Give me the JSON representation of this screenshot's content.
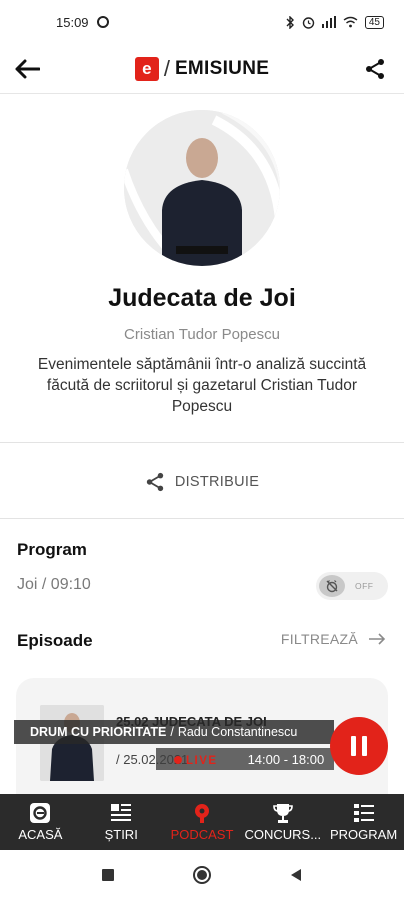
{
  "status_bar": {
    "time": "15:09",
    "battery": "45"
  },
  "app_bar": {
    "logo_letter": "e",
    "section_title": "EMISIUNE"
  },
  "show": {
    "title": "Judecata de Joi",
    "host": "Cristian Tudor Popescu",
    "description": "Evenimentele săptămânii într-o analiză succintă făcută de scriitorul și gazetarul Cristian Tudor Popescu"
  },
  "share": {
    "label": "DISTRIBUIE"
  },
  "program": {
    "heading": "Program",
    "schedule": "Joi / 09:10",
    "notify_state": "OFF"
  },
  "episodes": {
    "heading": "Episoade",
    "filter_label": "FILTREAZĂ",
    "items": [
      {
        "title": "25.02 JUDECATA DE JOI",
        "date": "/  25.02.2021"
      }
    ]
  },
  "player": {
    "show_name": "DRUM CU PRIORITATE",
    "separator": "/",
    "host": "Radu Constantinescu",
    "live_label": "LIVE",
    "time_range": "14:00 - 18:00"
  },
  "bottom_nav": {
    "items": [
      {
        "label": "ACASĂ",
        "icon": "home-logo-icon"
      },
      {
        "label": "ȘTIRI",
        "icon": "news-icon"
      },
      {
        "label": "PODCAST",
        "icon": "podcast-icon"
      },
      {
        "label": "CONCURS...",
        "icon": "trophy-icon"
      },
      {
        "label": "PROGRAM",
        "icon": "schedule-icon"
      }
    ]
  },
  "colors": {
    "brand": "#e2231a",
    "nav_bg": "#2b2b2b"
  }
}
